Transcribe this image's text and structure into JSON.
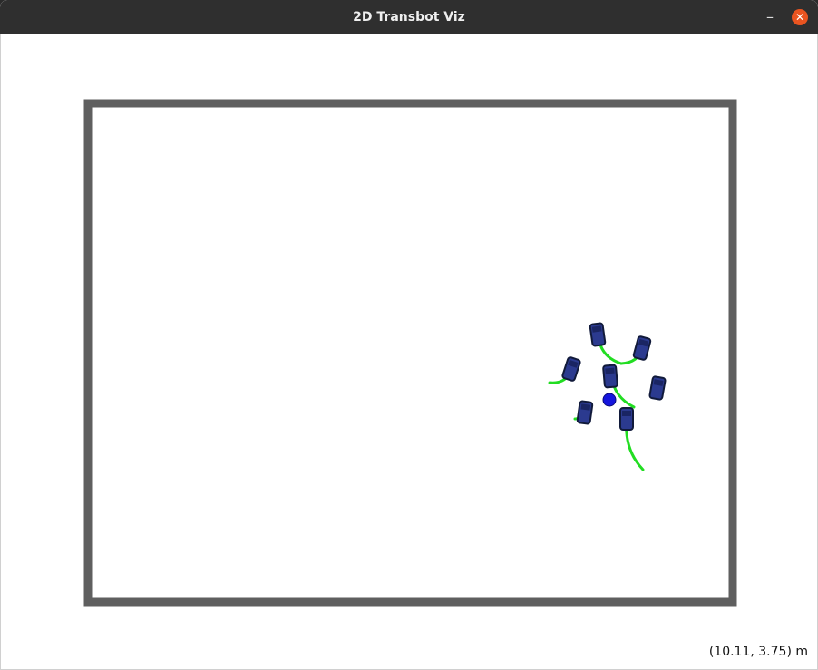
{
  "window": {
    "title": "2D Transbot Viz",
    "minimize_label": "–",
    "close_label": "✕"
  },
  "status": {
    "coordinate_readout": "(10.11, 3.75) m"
  },
  "colors": {
    "wall": "#5f5f5f",
    "robot_body": "#2b3a8f",
    "robot_outline": "#111a3a",
    "trail": "#22dd22",
    "target": "#1515dd"
  },
  "icons": {
    "minimize": "minimize-icon",
    "close": "close-icon",
    "robot": "robot-icon",
    "target": "target-marker-icon"
  }
}
